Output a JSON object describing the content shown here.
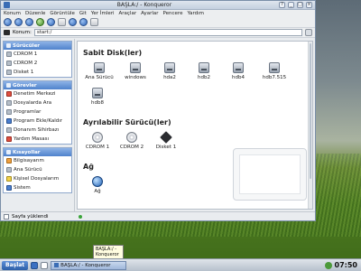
{
  "window": {
    "title": "BAŞLA:/ - Konqueror",
    "controls": [
      "?",
      "_",
      "□",
      "×"
    ]
  },
  "menu": [
    "Konum",
    "Düzenle",
    "Görüntüle",
    "Git",
    "Yer İmleri",
    "Araçlar",
    "Ayarlar",
    "Pencere",
    "Yardım"
  ],
  "toolbar": {
    "buttons": [
      "back-icon",
      "forward-icon",
      "up-icon",
      "reload-icon",
      "stop-icon",
      "home-icon",
      "zoom-in-icon",
      "zoom-out-icon",
      "find-icon"
    ]
  },
  "location": {
    "label": "Konum:",
    "value": "start:/"
  },
  "sidebar": {
    "drives": {
      "title": "Sürücüler",
      "items": [
        "CDROM 1",
        "CDROM 2",
        "Disket 1"
      ]
    },
    "tasks": {
      "title": "Görevler",
      "items": [
        "Denetim Merkezi",
        "Dosyalarda Ara",
        "Programlar",
        "Program Ekle/Kaldır",
        "Donanım Sihirbazı",
        "Yardım Masası"
      ]
    },
    "shortcuts": {
      "title": "Kısayollar",
      "items": [
        "Bilgisayarım",
        "Ana Sürücü",
        "Kişisel Dosyalarım",
        "Sistem"
      ]
    }
  },
  "main": {
    "fixed_disks": {
      "title": "Sabit Disk(ler)",
      "items": [
        "Ana Sürücü",
        "windows",
        "hda2",
        "hdb2",
        "hdb4",
        "hdb7.515",
        "hdb8"
      ]
    },
    "removable": {
      "title": "Ayrılabilir Sürücü(ler)",
      "items": [
        "CDROM 1",
        "CDROM 2",
        "Disket 1"
      ]
    },
    "network": {
      "title": "Ağ",
      "items": [
        "Ağ"
      ]
    }
  },
  "status": {
    "text": "Sayfa yüklendi"
  },
  "tooltip": {
    "text": "BAŞLA:/ - Konqueror"
  },
  "taskbar": {
    "start_label": "Başlat",
    "task_label": "BAŞLA:/ - Konqueror",
    "clock": "07:50"
  }
}
